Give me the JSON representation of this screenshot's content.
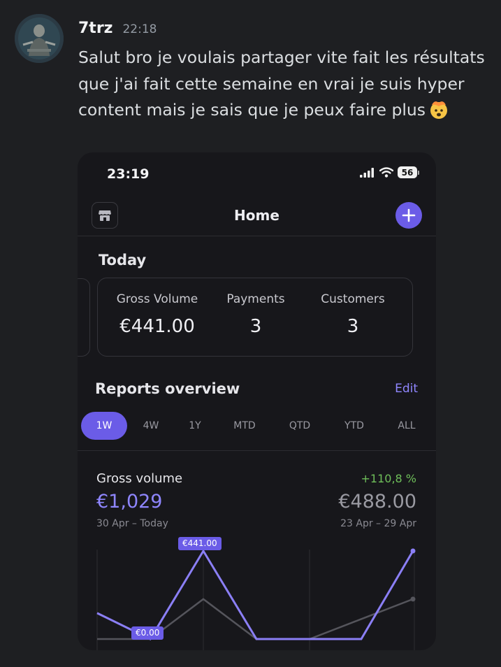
{
  "message": {
    "author": "7trz",
    "timestamp": "22:18",
    "text": "Salut bro je voulais partager vite fait les résultats que j'ai fait cette semaine en vrai je suis hyper content mais je sais que je peux faire plus"
  },
  "phone": {
    "status_bar": {
      "time": "23:19",
      "battery": "56"
    },
    "nav": {
      "title": "Home"
    },
    "today": {
      "title": "Today",
      "stats": [
        {
          "label": "Gross Volume",
          "value": "€441.00"
        },
        {
          "label": "Payments",
          "value": "3"
        },
        {
          "label": "Customers",
          "value": "3"
        }
      ]
    },
    "reports": {
      "title": "Reports overview",
      "edit_label": "Edit",
      "tabs": [
        "1W",
        "4W",
        "1Y",
        "MTD",
        "QTD",
        "YTD",
        "ALL"
      ],
      "active_tab": "1W"
    },
    "gross_volume": {
      "label": "Gross volume",
      "change": "+110,8 %",
      "current_value": "€1,029",
      "current_range": "30 Apr – Today",
      "previous_value": "€488.00",
      "previous_range": "23 Apr – 29 Apr"
    }
  },
  "chart_data": {
    "type": "line",
    "series": [
      {
        "values": [
          130,
          0,
          441,
          0,
          0,
          0,
          441
        ]
      },
      {
        "values": [
          0,
          0,
          200,
          0,
          0,
          100,
          200
        ]
      }
    ],
    "annotations": [
      {
        "text": "€441.00",
        "value": 441
      },
      {
        "text": "€0.00",
        "value": 0
      }
    ],
    "colors": {
      "current": "#8b7ff6",
      "previous": "#55555c"
    },
    "grid": true
  }
}
